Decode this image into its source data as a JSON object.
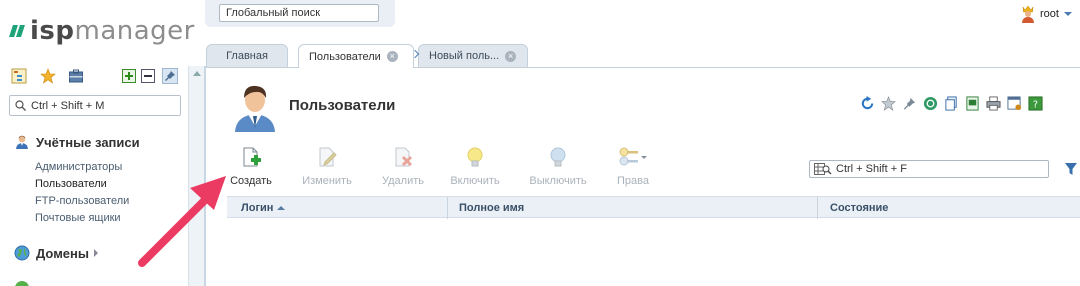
{
  "brand": {
    "prefix": "isp",
    "suffix": "manager"
  },
  "global_search": {
    "placeholder": "Глобальный поиск"
  },
  "user": {
    "name": "root"
  },
  "left_panel": {
    "search_placeholder": "Ctrl + Shift + M",
    "sections": [
      {
        "title": "Учётные записи",
        "items": [
          "Администраторы",
          "Пользователи",
          "FTP-пользователи",
          "Почтовые ящики"
        ],
        "active_index": 1
      },
      {
        "title": "Домены"
      }
    ]
  },
  "tabs": [
    {
      "label": "Главная"
    },
    {
      "label": "Пользователи",
      "active": true
    },
    {
      "label": "Новый поль..."
    }
  ],
  "page": {
    "title": "Пользователи"
  },
  "toolbar": {
    "create": "Создать",
    "edit": "Изменить",
    "delete": "Удалить",
    "enable": "Включить",
    "disable": "Выключить",
    "rights": "Права"
  },
  "filter": {
    "placeholder": "Ctrl + Shift + F"
  },
  "table": {
    "columns": [
      "Логин",
      "Полное имя",
      "Состояние"
    ]
  },
  "colors": {
    "accent_green": "#1fa37a",
    "arrow": "#ec3b63",
    "header_bg": "#eaf0f6",
    "link": "#4a5d70"
  },
  "icons": [
    "tree-icon",
    "star-icon",
    "briefcase-icon",
    "expand-icon",
    "collapse-icon",
    "pin-icon",
    "search-icon",
    "user-icon",
    "globe-icon",
    "refresh-icon",
    "filter-icon"
  ]
}
